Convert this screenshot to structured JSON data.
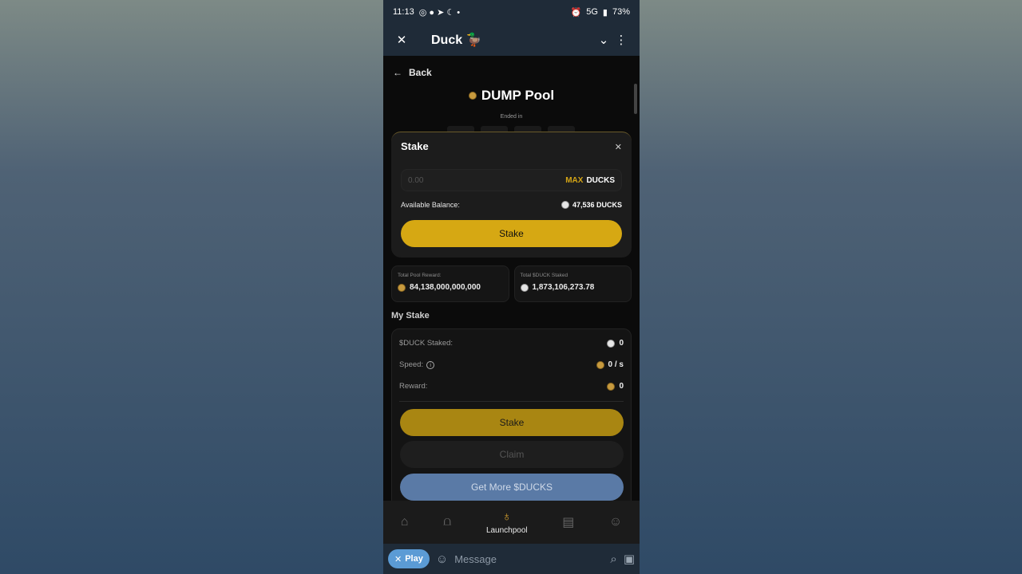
{
  "status": {
    "time": "11:13",
    "battery": "73%",
    "network": "5G"
  },
  "header": {
    "title": "Duck 🦆"
  },
  "page": {
    "back_label": "Back",
    "pool_title": "DUMP Pool",
    "ended_label": "Ended in"
  },
  "modal": {
    "title": "Stake",
    "amount_placeholder": "0.00",
    "max_label": "MAX",
    "unit_label": "DUCKS",
    "balance_label": "Available Balance:",
    "balance_value": "47,536 DUCKS",
    "stake_button": "Stake"
  },
  "stats": [
    {
      "label": "Total Pool Reward:",
      "value": "84,138,000,000,000"
    },
    {
      "label": "Total $DUCK Staked",
      "value": "1,873,106,273.78"
    }
  ],
  "my_stake": {
    "title": "My Stake",
    "rows": [
      {
        "label": "$DUCK Staked:",
        "value": "0"
      },
      {
        "label": "Speed:",
        "value": "0 / s"
      },
      {
        "label": "Reward:",
        "value": "0"
      }
    ],
    "stake_button": "Stake",
    "claim_button": "Claim",
    "more_button": "Get More $DUCKS"
  },
  "nav": {
    "active_label": "Launchpool"
  },
  "composer": {
    "play_label": "Play",
    "placeholder": "Message"
  },
  "colors": {
    "accent": "#d6a813",
    "bg": "#0b0b0b",
    "tg": "#1f2b38",
    "more": "#5a7aa6"
  }
}
